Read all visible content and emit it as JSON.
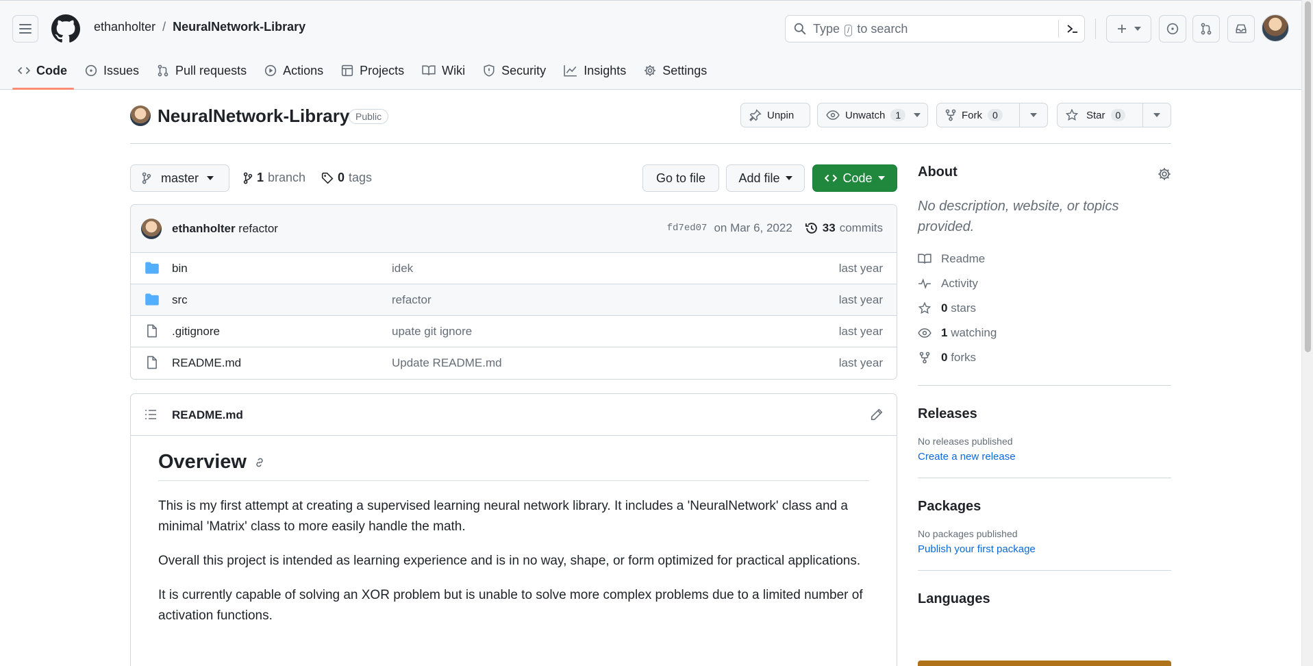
{
  "header": {
    "owner": "ethanholter",
    "separator": "/",
    "repo": "NeuralNetwork-Library",
    "search_prefix": "Type",
    "search_key": "/",
    "search_suffix": "to search"
  },
  "tabs": [
    {
      "label": "Code",
      "icon": "code-icon"
    },
    {
      "label": "Issues",
      "icon": "issue-icon"
    },
    {
      "label": "Pull requests",
      "icon": "pull-request-icon"
    },
    {
      "label": "Actions",
      "icon": "play-icon"
    },
    {
      "label": "Projects",
      "icon": "table-icon"
    },
    {
      "label": "Wiki",
      "icon": "book-icon"
    },
    {
      "label": "Security",
      "icon": "shield-icon"
    },
    {
      "label": "Insights",
      "icon": "graph-icon"
    },
    {
      "label": "Settings",
      "icon": "gear-icon"
    }
  ],
  "repo": {
    "title": "NeuralNetwork-Library",
    "visibility": "Public",
    "unpin": "Unpin",
    "unwatch": "Unwatch",
    "watch_count": "1",
    "fork": "Fork",
    "fork_count": "0",
    "star": "Star",
    "star_count": "0"
  },
  "toolbar": {
    "branch": "master",
    "branch_count": "1",
    "branch_label": "branch",
    "tag_count": "0",
    "tag_label": "tags",
    "goto": "Go to file",
    "addfile": "Add file",
    "code": "Code"
  },
  "commit": {
    "author": "ethanholter",
    "message": "refactor",
    "sha": "fd7ed07",
    "date": "on Mar 6, 2022",
    "count": "33",
    "count_label": "commits"
  },
  "files": [
    {
      "name": "bin",
      "type": "folder",
      "message": "idek",
      "date": "last year"
    },
    {
      "name": "src",
      "type": "folder",
      "message": "refactor",
      "date": "last year"
    },
    {
      "name": ".gitignore",
      "type": "file",
      "message": "upate git ignore",
      "date": "last year"
    },
    {
      "name": "README.md",
      "type": "file",
      "message": "Update README.md",
      "date": "last year"
    }
  ],
  "readme": {
    "filename": "README.md",
    "heading": "Overview",
    "paragraphs": [
      "This is my first attempt at creating a supervised learning neural network library. It includes a 'NeuralNetwork' class and a minimal 'Matrix' class to more easily handle the math.",
      "Overall this project is intended as learning experience and is in no way, shape, or form optimized for practical applications.",
      "It is currently capable of solving an XOR problem but is unable to solve more complex problems due to a limited number of activation functions."
    ]
  },
  "sidebar": {
    "about_title": "About",
    "about_desc": "No description, website, or topics provided.",
    "readme": "Readme",
    "activity": "Activity",
    "stars_count": "0",
    "stars_label": "stars",
    "watching_count": "1",
    "watching_label": "watching",
    "forks_count": "0",
    "forks_label": "forks",
    "releases_title": "Releases",
    "releases_none": "No releases published",
    "releases_link": "Create a new release",
    "packages_title": "Packages",
    "packages_none": "No packages published",
    "packages_link": "Publish your first package",
    "languages_title": "Languages"
  },
  "colors": {
    "accent_green": "#1f883d",
    "link_blue": "#0969da",
    "tab_underline": "#fd8c73",
    "folder_blue": "#54aeff",
    "lang_java": "#b07219"
  }
}
